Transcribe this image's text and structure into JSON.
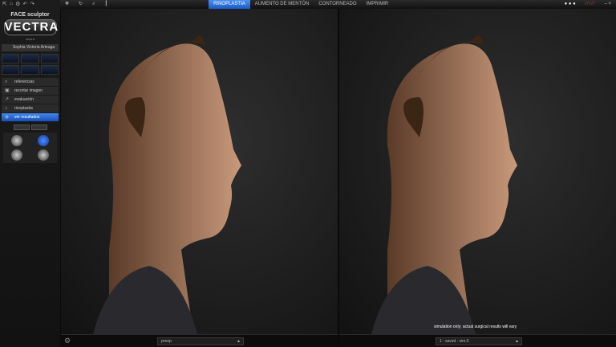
{
  "app": {
    "brand": "FACE sculptor",
    "logo": "VECTRA",
    "subtitle": "vectra"
  },
  "patient": {
    "name": "Sophia Victoria Arteaga"
  },
  "menu": [
    {
      "label": "referencias",
      "icon": "⌕"
    },
    {
      "label": "recortar imagen",
      "icon": "▣"
    },
    {
      "label": "evaluación",
      "icon": "↗"
    },
    {
      "label": "rinoplastia",
      "icon": "♪"
    },
    {
      "label": "ver resultados",
      "icon": "◉",
      "active": true
    }
  ],
  "tabs": [
    {
      "label": "RINOPLASTIA",
      "active": true
    },
    {
      "label": "AUMENTO DE MENTÓN"
    },
    {
      "label": "CONTORNEADO"
    },
    {
      "label": "IMPRIMIR"
    }
  ],
  "viewport_left": {
    "dropdown": "preop"
  },
  "viewport_right": {
    "dropdown": "1 : saved : sim.0",
    "note": "simulation only; actual surgical results will vary"
  }
}
